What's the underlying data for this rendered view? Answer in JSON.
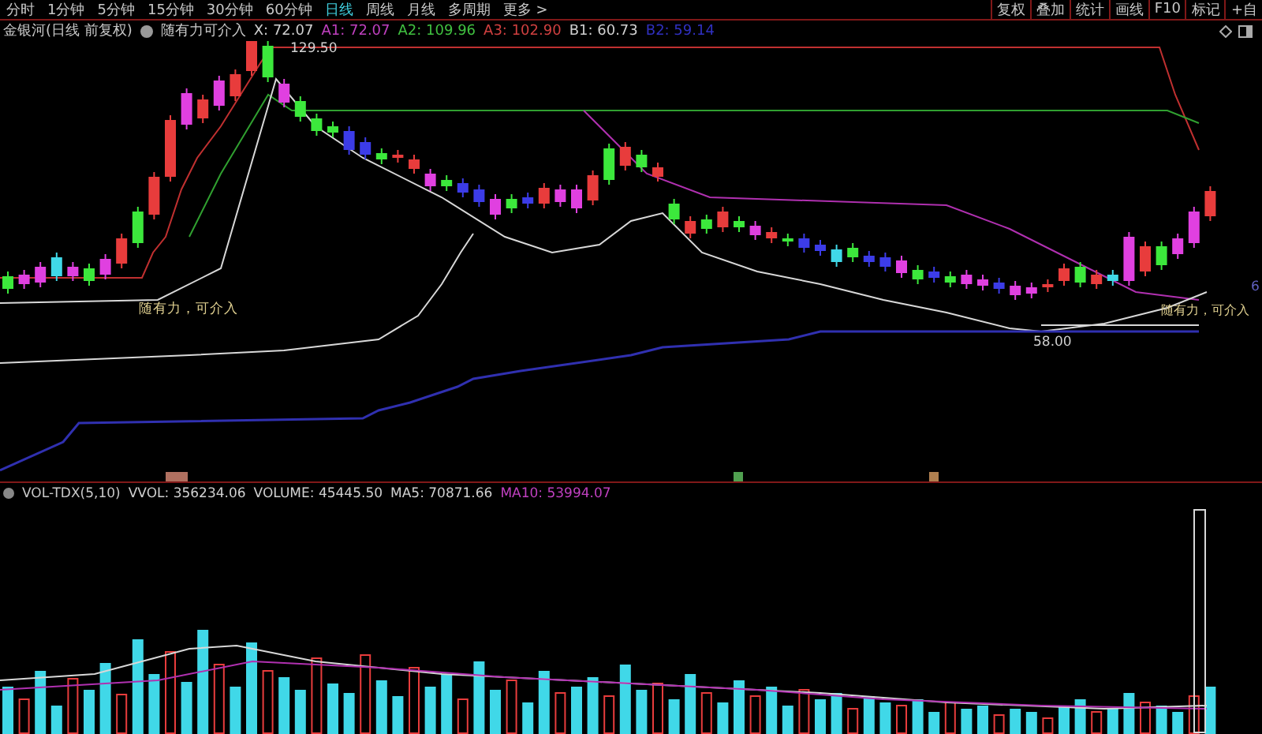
{
  "toolbar": {
    "periods": [
      {
        "label": "分时",
        "selected": false
      },
      {
        "label": "1分钟",
        "selected": false
      },
      {
        "label": "5分钟",
        "selected": false
      },
      {
        "label": "15分钟",
        "selected": false
      },
      {
        "label": "30分钟",
        "selected": false
      },
      {
        "label": "60分钟",
        "selected": false
      },
      {
        "label": "日线",
        "selected": true
      },
      {
        "label": "周线",
        "selected": false
      },
      {
        "label": "月线",
        "selected": false
      },
      {
        "label": "多周期",
        "selected": false
      },
      {
        "label": "更多 >",
        "selected": false
      }
    ],
    "buttons": [
      "复权",
      "叠加",
      "统计",
      "画线",
      "F10",
      "标记",
      "+自"
    ]
  },
  "legend": {
    "title": "金银河(日线 前复权)",
    "indicator": "随有力可介入",
    "values": [
      {
        "text": "X: 72.07",
        "color": "#d0d0d0"
      },
      {
        "text": "A1: 72.07",
        "color": "#c040c0"
      },
      {
        "text": "A2: 109.96",
        "color": "#40c040"
      },
      {
        "text": "A3: 102.90",
        "color": "#d04040"
      },
      {
        "text": "B1: 60.73",
        "color": "#d0d0d0"
      },
      {
        "text": "B2: 59.14",
        "color": "#3030c0"
      }
    ]
  },
  "chart": {
    "high_label": "129.50",
    "low_label": "58.00",
    "signals": [
      "随有力，可介入",
      "随有力，可介入"
    ],
    "axis_label": "6"
  },
  "volume_legend": {
    "title": "VOL-TDX(5,10)",
    "values": [
      {
        "text": "VVOL: 356234.06",
        "color": "#d0d0d0"
      },
      {
        "text": "VOLUME: 45445.50",
        "color": "#d0d0d0"
      },
      {
        "text": "MA5: 70871.66",
        "color": "#d0d0d0"
      },
      {
        "text": "MA10: 53994.07",
        "color": "#c040c0"
      }
    ]
  }
}
